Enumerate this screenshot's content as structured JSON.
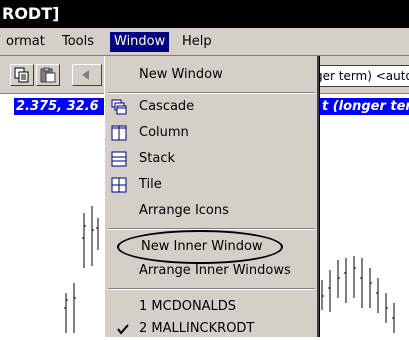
{
  "window": {
    "title": "RODT]"
  },
  "menubar": {
    "items": [
      {
        "label": "ormat"
      },
      {
        "label": "Tools"
      },
      {
        "label": "Window"
      },
      {
        "label": "Help"
      }
    ]
  },
  "toolbar": {
    "combo_value": "ger term) <auto:"
  },
  "infobar": {
    "left_text": "2.375, 32.6",
    "right_text": "t (longer term"
  },
  "window_menu": {
    "new_window": "New Window",
    "cascade": "Cascade",
    "column": "Column",
    "stack": "Stack",
    "tile": "Tile",
    "arrange_icons": "Arrange Icons",
    "new_inner_window": "New Inner Window",
    "arrange_inner_windows": "Arrange Inner Windows",
    "doc1": "1 MCDONALDS",
    "doc2": "2 MALLINCKRODT"
  },
  "icons": {
    "cascade": "cascade-icon",
    "column": "column-icon",
    "stack": "stack-icon",
    "tile": "tile-icon",
    "check": "checkmark-icon"
  },
  "colors": {
    "menu_bg": "#d4d0c8",
    "highlight": "#000080",
    "info_blue": "#0000ff",
    "icon_blue": "#000080"
  }
}
